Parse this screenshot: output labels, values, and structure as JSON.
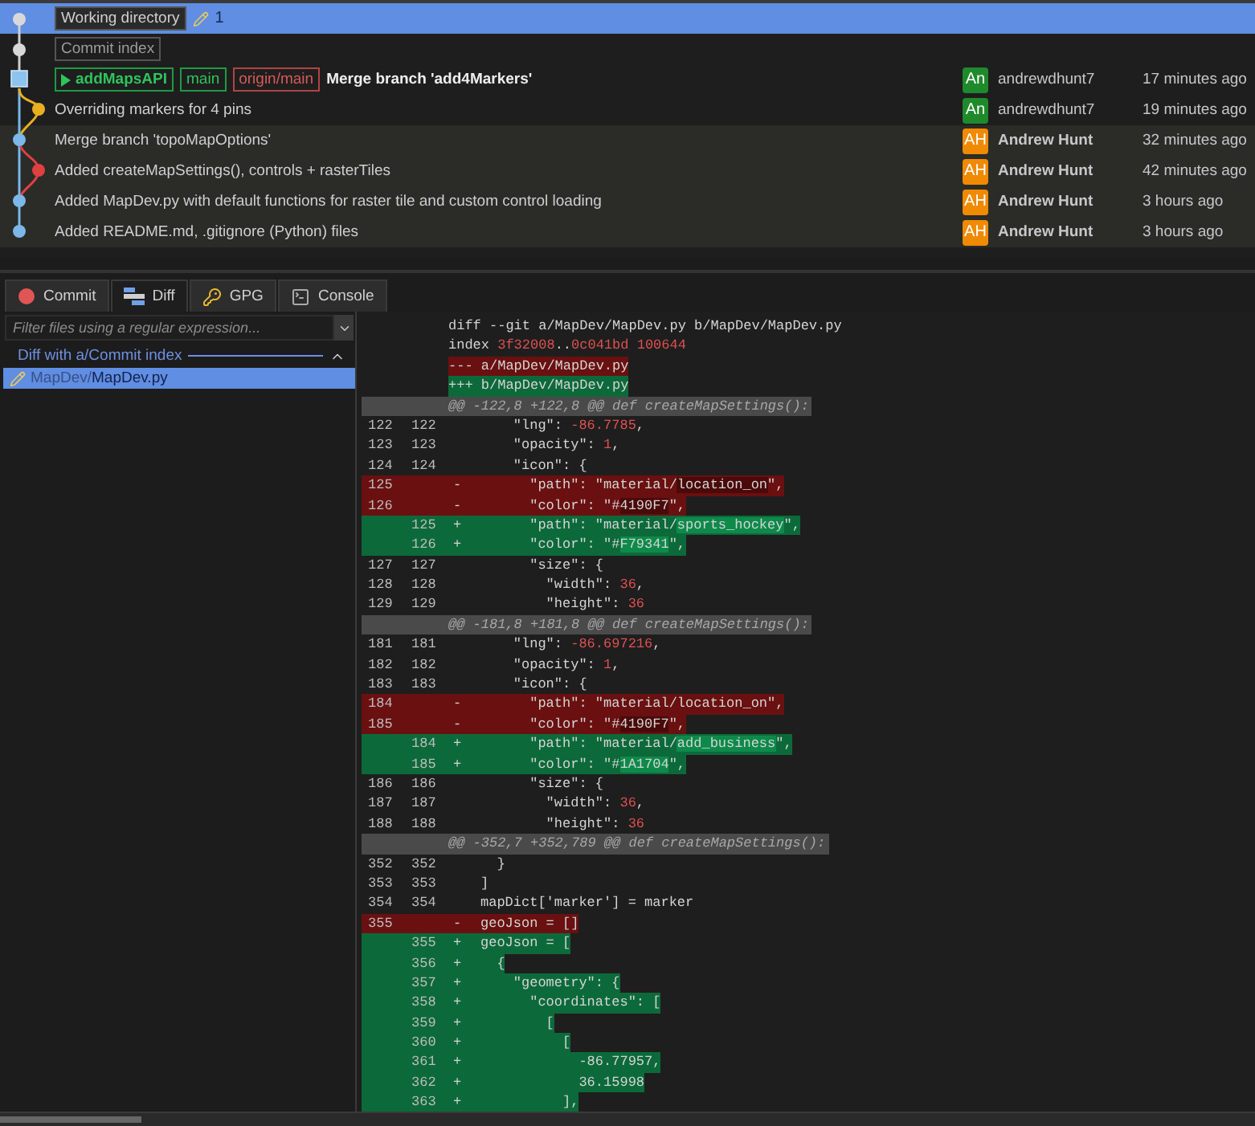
{
  "commits": [
    {
      "selected": true,
      "shaded": false,
      "tags": [
        {
          "kind": "working",
          "label": "Working directory"
        }
      ],
      "changes": "1"
    },
    {
      "selected": false,
      "shaded": false,
      "tags": [
        {
          "kind": "index",
          "label": "Commit index"
        }
      ]
    },
    {
      "selected": false,
      "shaded": false,
      "head": true,
      "tags": [
        {
          "kind": "head",
          "label": "addMapsAPI"
        },
        {
          "kind": "local",
          "label": "main"
        },
        {
          "kind": "remote",
          "label": "origin/main"
        }
      ],
      "message": "Merge branch 'add4Markers'",
      "author": {
        "initials": "An",
        "name": "andrewdhunt7",
        "color": "#1f8a2b",
        "bold": false
      },
      "time": "17 minutes ago"
    },
    {
      "selected": false,
      "shaded": false,
      "head": false,
      "message": "Overriding markers for 4 pins",
      "author": {
        "initials": "An",
        "name": "andrewdhunt7",
        "color": "#1f8a2b",
        "bold": false
      },
      "time": "19 minutes ago"
    },
    {
      "selected": false,
      "shaded": true,
      "head": false,
      "message": "Merge branch 'topoMapOptions'",
      "author": {
        "initials": "AH",
        "name": "Andrew Hunt",
        "color": "#f08a00",
        "bold": true
      },
      "time": "32 minutes ago"
    },
    {
      "selected": false,
      "shaded": true,
      "head": false,
      "message": "Added createMapSettings(), controls + rasterTiles",
      "author": {
        "initials": "AH",
        "name": "Andrew Hunt",
        "color": "#f08a00",
        "bold": true
      },
      "time": "42 minutes ago"
    },
    {
      "selected": false,
      "shaded": true,
      "head": false,
      "message": "Added MapDev.py with default functions for raster tile and custom control loading",
      "author": {
        "initials": "AH",
        "name": "Andrew Hunt",
        "color": "#f08a00",
        "bold": true
      },
      "time": "3 hours ago"
    },
    {
      "selected": false,
      "shaded": true,
      "head": false,
      "message": "Added README.md, .gitignore (Python) files",
      "author": {
        "initials": "AH",
        "name": "Andrew Hunt",
        "color": "#f08a00",
        "bold": true
      },
      "time": "3 hours ago"
    }
  ],
  "tabs": [
    {
      "kind": "commit",
      "label": "Commit",
      "selected": false
    },
    {
      "kind": "diff",
      "label": "Diff",
      "selected": true
    },
    {
      "kind": "gpg",
      "label": "GPG",
      "selected": false
    },
    {
      "kind": "console",
      "label": "Console",
      "selected": false
    }
  ],
  "filter": {
    "placeholder": "Filter files using a regular expression..."
  },
  "file_group": {
    "title": "Diff with a/Commit index",
    "expanded": true
  },
  "files": [
    {
      "dir": "MapDev/",
      "name": "MapDev.py",
      "selected": true
    }
  ],
  "diff_lines": [
    {
      "kind": "meta",
      "code": [
        {
          "t": "diff --git a/MapDev/MapDev.py b/MapDev/MapDev.py"
        }
      ]
    },
    {
      "kind": "meta",
      "code": [
        {
          "t": "index "
        },
        {
          "t": "3f32008",
          "number": true
        },
        {
          "t": ".."
        },
        {
          "t": "0c041bd 100644",
          "number": true
        }
      ]
    },
    {
      "kind": "file-old",
      "text": "--- a/MapDev/MapDev.py"
    },
    {
      "kind": "file-new",
      "text": "+++ b/MapDev/MapDev.py"
    },
    {
      "kind": "hunk",
      "text": "@@ -122,8 +122,8 @@ def createMapSettings():"
    },
    {
      "kind": "ctx",
      "old": "122",
      "new": "122",
      "code": [
        {
          "t": "    \"lng\": "
        },
        {
          "t": "-86.7785",
          "number": true
        },
        {
          "t": ","
        }
      ]
    },
    {
      "kind": "ctx",
      "old": "123",
      "new": "123",
      "code": [
        {
          "t": "    \"opacity\": "
        },
        {
          "t": "1",
          "number": true
        },
        {
          "t": ","
        }
      ]
    },
    {
      "kind": "ctx",
      "old": "124",
      "new": "124",
      "code": [
        {
          "t": "    \"icon\": {"
        }
      ]
    },
    {
      "kind": "del",
      "old": "125",
      "sign": "-",
      "code": [
        {
          "t": "      \"path\": \"material/"
        },
        {
          "t": "location_on",
          "highlight": true
        },
        {
          "t": "\","
        }
      ]
    },
    {
      "kind": "del",
      "old": "126",
      "sign": "-",
      "code": [
        {
          "t": "      \"color\": \"#"
        },
        {
          "t": "4190F7",
          "highlight": true
        },
        {
          "t": "\","
        }
      ]
    },
    {
      "kind": "add",
      "new": "125",
      "sign": "+",
      "code": [
        {
          "t": "      \"path\": \"material/"
        },
        {
          "t": "sports_hockey",
          "highlight": true
        },
        {
          "t": "\","
        }
      ]
    },
    {
      "kind": "add",
      "new": "126",
      "sign": "+",
      "code": [
        {
          "t": "      \"color\": \"#"
        },
        {
          "t": "F79341",
          "highlight": true
        },
        {
          "t": "\","
        }
      ]
    },
    {
      "kind": "ctx",
      "old": "127",
      "new": "127",
      "code": [
        {
          "t": "      \"size\": {"
        }
      ]
    },
    {
      "kind": "ctx",
      "old": "128",
      "new": "128",
      "code": [
        {
          "t": "        \"width\": "
        },
        {
          "t": "36",
          "number": true
        },
        {
          "t": ","
        }
      ]
    },
    {
      "kind": "ctx",
      "old": "129",
      "new": "129",
      "code": [
        {
          "t": "        \"height\": "
        },
        {
          "t": "36",
          "number": true
        }
      ]
    },
    {
      "kind": "hunk",
      "text": "@@ -181,8 +181,8 @@ def createMapSettings():"
    },
    {
      "kind": "ctx",
      "old": "181",
      "new": "181",
      "code": [
        {
          "t": "    \"lng\": "
        },
        {
          "t": "-86.697216",
          "number": true
        },
        {
          "t": ","
        }
      ]
    },
    {
      "kind": "ctx",
      "old": "182",
      "new": "182",
      "code": [
        {
          "t": "    \"opacity\": "
        },
        {
          "t": "1",
          "number": true
        },
        {
          "t": ","
        }
      ]
    },
    {
      "kind": "ctx",
      "old": "183",
      "new": "183",
      "code": [
        {
          "t": "    \"icon\": {"
        }
      ]
    },
    {
      "kind": "del",
      "old": "184",
      "sign": "-",
      "code": [
        {
          "t": "      \"path\": \"material/location_on\","
        }
      ]
    },
    {
      "kind": "del",
      "old": "185",
      "sign": "-",
      "code": [
        {
          "t": "      \"color\": \"#"
        },
        {
          "t": "4190F7",
          "highlight": true
        },
        {
          "t": "\","
        }
      ]
    },
    {
      "kind": "add",
      "new": "184",
      "sign": "+",
      "code": [
        {
          "t": "      \"path\": \"material/"
        },
        {
          "t": "add_business",
          "highlight": true
        },
        {
          "t": "\","
        }
      ]
    },
    {
      "kind": "add",
      "new": "185",
      "sign": "+",
      "code": [
        {
          "t": "      \"color\": \"#"
        },
        {
          "t": "1A1704",
          "highlight": true
        },
        {
          "t": "\","
        }
      ]
    },
    {
      "kind": "ctx",
      "old": "186",
      "new": "186",
      "code": [
        {
          "t": "      \"size\": {"
        }
      ]
    },
    {
      "kind": "ctx",
      "old": "187",
      "new": "187",
      "code": [
        {
          "t": "        \"width\": "
        },
        {
          "t": "36",
          "number": true
        },
        {
          "t": ","
        }
      ]
    },
    {
      "kind": "ctx",
      "old": "188",
      "new": "188",
      "code": [
        {
          "t": "        \"height\": "
        },
        {
          "t": "36",
          "number": true
        }
      ]
    },
    {
      "kind": "hunk",
      "text": "@@ -352,7 +352,789 @@ def createMapSettings():"
    },
    {
      "kind": "ctx",
      "old": "352",
      "new": "352",
      "code": [
        {
          "t": "  }"
        }
      ]
    },
    {
      "kind": "ctx",
      "old": "353",
      "new": "353",
      "code": [
        {
          "t": "]"
        }
      ]
    },
    {
      "kind": "ctx",
      "old": "354",
      "new": "354",
      "code": [
        {
          "t": "mapDict['marker'] = marker"
        }
      ]
    },
    {
      "kind": "del",
      "old": "355",
      "sign": "-",
      "code": [
        {
          "t": "geoJson = []"
        }
      ]
    },
    {
      "kind": "add",
      "new": "355",
      "sign": "+",
      "code": [
        {
          "t": "geoJson = ["
        }
      ]
    },
    {
      "kind": "add",
      "new": "356",
      "sign": "+",
      "code": [
        {
          "t": "  {"
        }
      ]
    },
    {
      "kind": "add",
      "new": "357",
      "sign": "+",
      "code": [
        {
          "t": "    \"geometry\": {"
        }
      ]
    },
    {
      "kind": "add",
      "new": "358",
      "sign": "+",
      "code": [
        {
          "t": "      \"coordinates\": ["
        }
      ]
    },
    {
      "kind": "add",
      "new": "359",
      "sign": "+",
      "code": [
        {
          "t": "        ["
        }
      ]
    },
    {
      "kind": "add",
      "new": "360",
      "sign": "+",
      "code": [
        {
          "t": "          ["
        }
      ]
    },
    {
      "kind": "add",
      "new": "361",
      "sign": "+",
      "code": [
        {
          "t": "            -86.77957,"
        }
      ]
    },
    {
      "kind": "add",
      "new": "362",
      "sign": "+",
      "code": [
        {
          "t": "            36.15998"
        }
      ]
    },
    {
      "kind": "add",
      "new": "363",
      "sign": "+",
      "code": [
        {
          "t": "          ],"
        }
      ]
    }
  ]
}
